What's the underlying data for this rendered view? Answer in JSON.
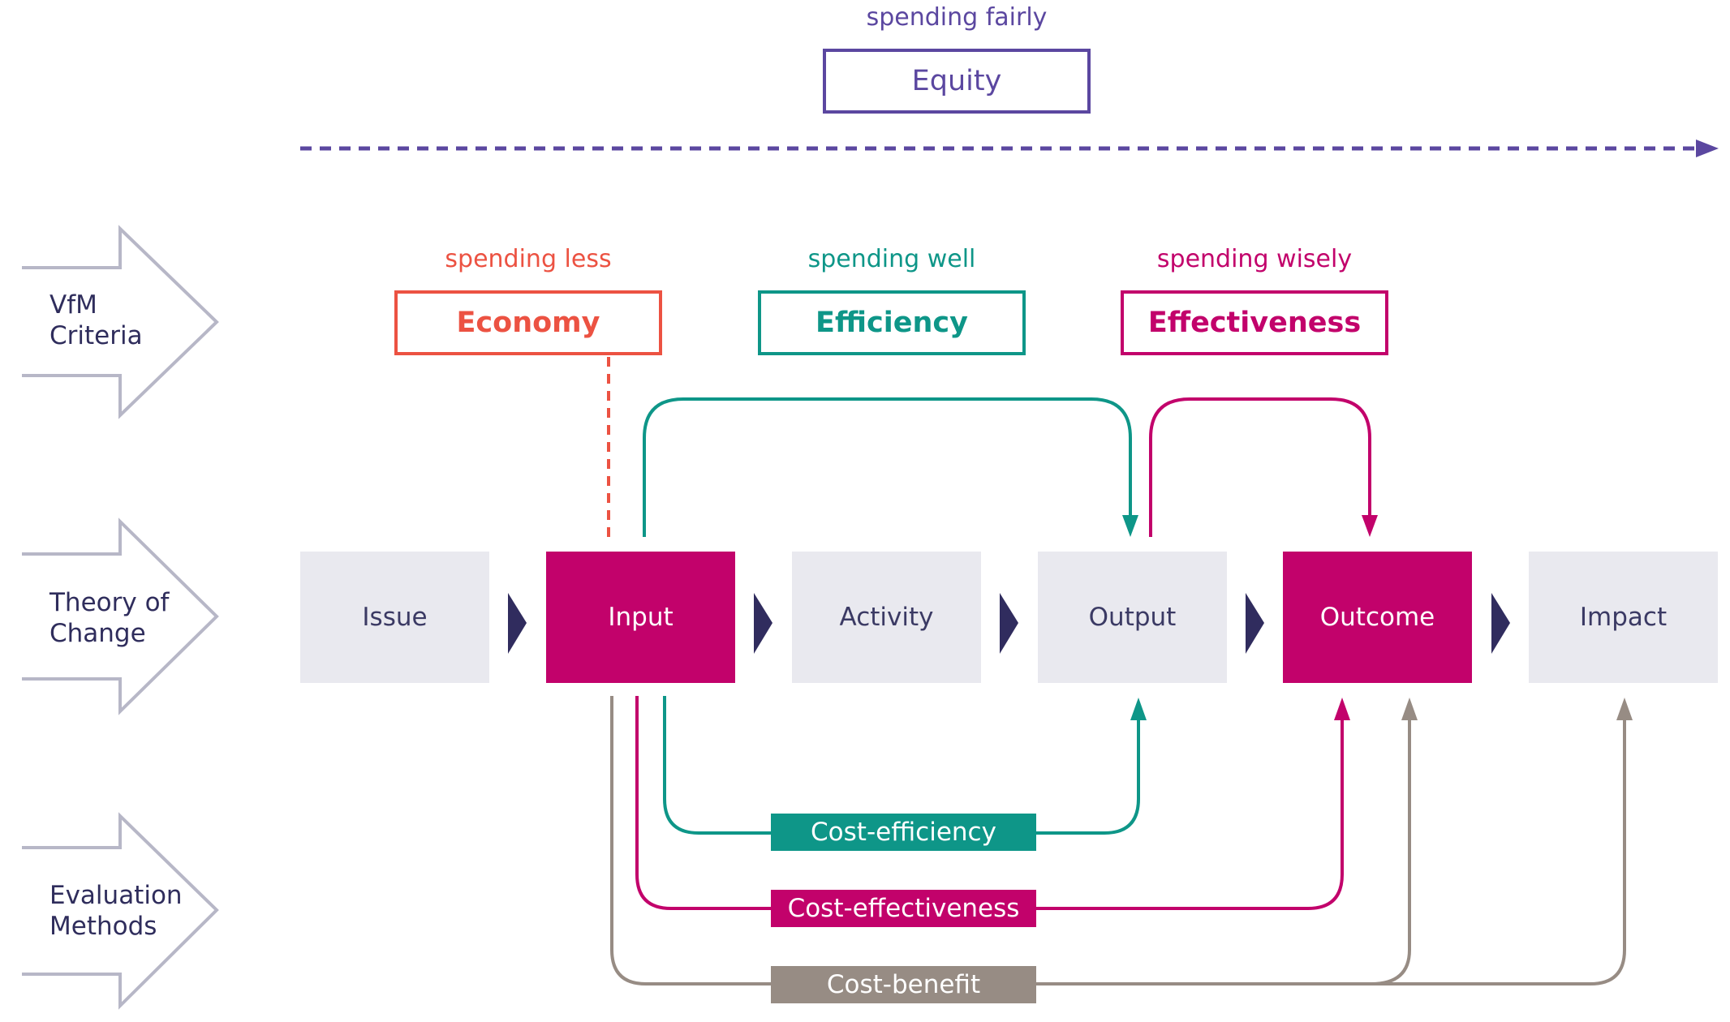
{
  "equity": {
    "subtitle": "spending fairly",
    "label": "Equity",
    "color": "#5b47a0"
  },
  "row_labels": {
    "vfm": [
      "VfM",
      "Criteria"
    ],
    "toc": [
      "Theory of",
      "Change"
    ],
    "eval": [
      "Evaluation",
      "Methods"
    ]
  },
  "criteria": [
    {
      "subtitle": "spending less",
      "label": "Economy",
      "color": "#ec5242"
    },
    {
      "subtitle": "spending well",
      "label": "Efficiency",
      "color": "#0e9688"
    },
    {
      "subtitle": "spending wisely",
      "label": "Effectiveness",
      "color": "#c2026b"
    }
  ],
  "stages": [
    {
      "label": "Issue",
      "highlight": false
    },
    {
      "label": "Input",
      "highlight": true
    },
    {
      "label": "Activity",
      "highlight": false
    },
    {
      "label": "Output",
      "highlight": false
    },
    {
      "label": "Outcome",
      "highlight": true
    },
    {
      "label": "Impact",
      "highlight": false
    }
  ],
  "methods": [
    {
      "label": "Cost-efficiency",
      "color": "#0e9688"
    },
    {
      "label": "Cost-effectiveness",
      "color": "#c2026b"
    },
    {
      "label": "Cost-benefit",
      "color": "#978c84"
    }
  ],
  "colors": {
    "row_arrow": "#b7b7c7",
    "chevron": "#302c5e",
    "stage_light": "#e9e9ef",
    "stage_accent": "#c2026b"
  }
}
